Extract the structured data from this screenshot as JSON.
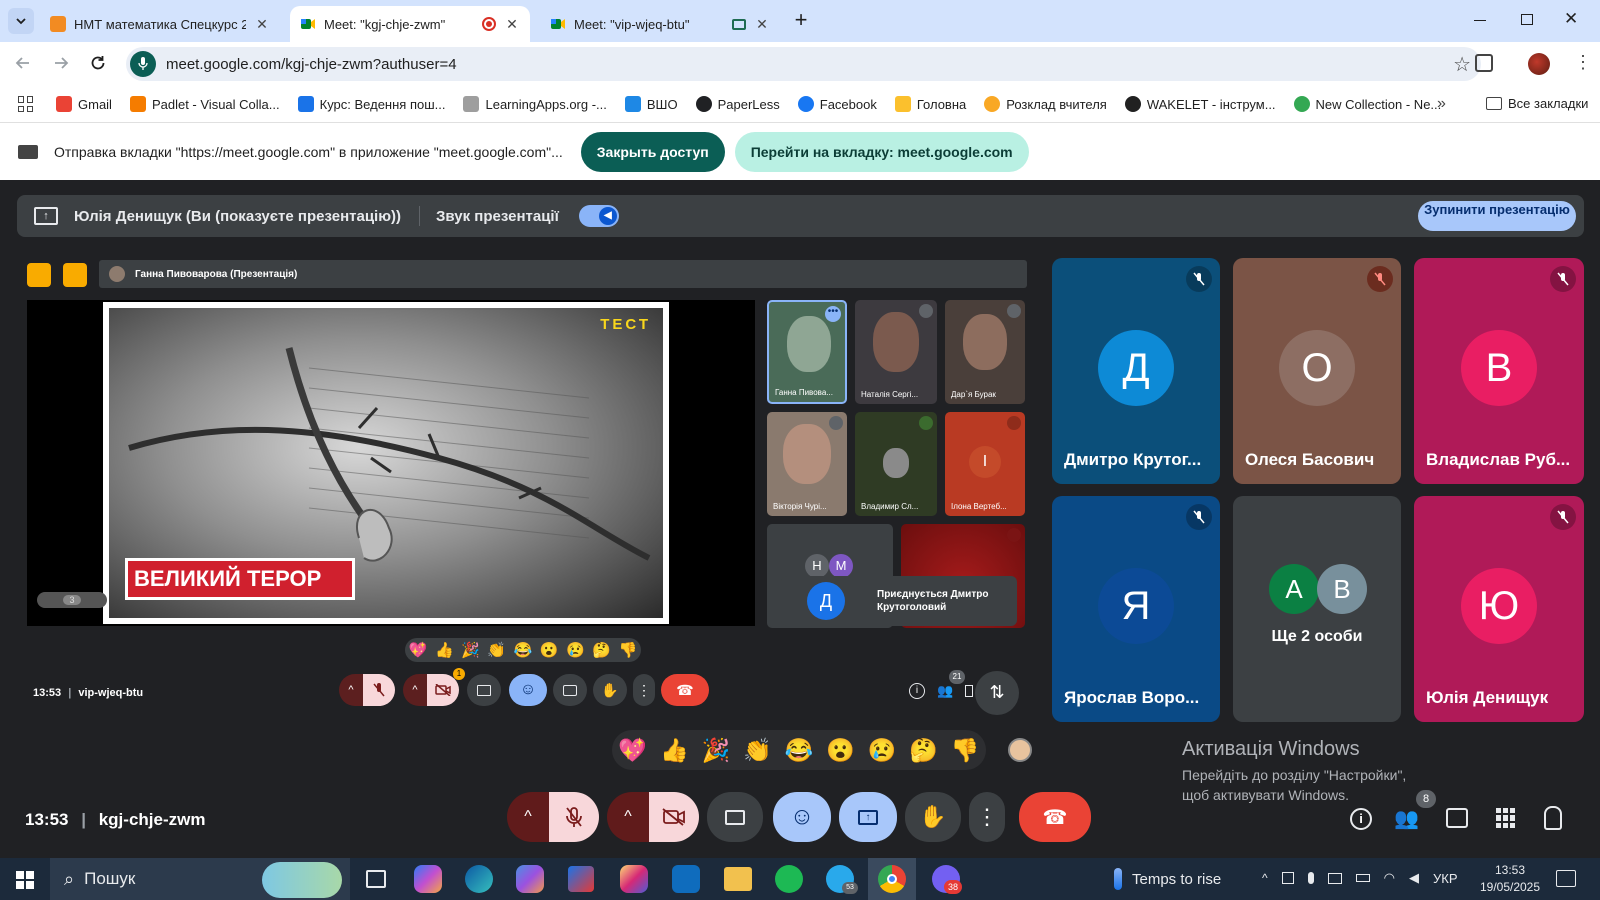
{
  "browser": {
    "tabs": [
      {
        "title": "НМТ математика Спецкурс 20",
        "icon": "orange-square-icon",
        "active": false
      },
      {
        "title": "Meet: \"kgj-chje-zwm\"",
        "icon": "google-meet-icon",
        "active": true,
        "recording": true
      },
      {
        "title": "Meet: \"vip-wjeq-btu\"",
        "icon": "google-meet-icon",
        "active": false
      }
    ],
    "url": "meet.google.com/kgj-chje-zwm?authuser=4",
    "bookmarks": [
      {
        "label": "Gmail",
        "color": "#ea4335"
      },
      {
        "label": "Padlet - Visual Colla...",
        "color": "#f57c00"
      },
      {
        "label": "Курс: Ведення пош...",
        "color": "#1a73e8"
      },
      {
        "label": "LearningApps.org -...",
        "color": "#9e9e9e"
      },
      {
        "label": "ВШО",
        "color": "#1e88e5"
      },
      {
        "label": "PaperLess",
        "color": "#202124"
      },
      {
        "label": "Facebook",
        "color": "#1877f2"
      },
      {
        "label": "Головна",
        "color": "#fbc02d"
      },
      {
        "label": "Розклад вчителя",
        "color": "#f9a825"
      },
      {
        "label": "WAKELET - інструм...",
        "color": "#212121"
      },
      {
        "label": "New Collection - Ne...",
        "color": "#34a853"
      }
    ],
    "all_bookmarks": "Все закладки"
  },
  "infobar": {
    "message": "Отправка вкладки \"https://meet.google.com\" в приложение \"meet.google.com\"...",
    "stop_label": "Закрыть доступ",
    "goto_label": "Перейти на вкладку: meet.google.com"
  },
  "presenting": {
    "text": "Юлія Денищук (Ви (показуєте презентацію))",
    "audio_label": "Звук презентації",
    "stop_label": "Зупинити презентацію"
  },
  "shared": {
    "presenter_label": "Ганна Пивоварова (Презентація)",
    "slide_title": "ВЕЛИКИЙ ТЕРОР",
    "slide_logo": "ТЕСТ",
    "slide_page": "3",
    "thumbs": [
      {
        "name": "Ганна Пивова...",
        "bg": "#4a6b58"
      },
      {
        "name": "Наталія Сергі...",
        "bg": "#3d3a3f"
      },
      {
        "name": "Дар`я Бурак",
        "bg": "#4a3f3a"
      },
      {
        "name": "Вікторія Чурі...",
        "bg": "#8a7a6e"
      },
      {
        "name": "Владимир Сл...",
        "bg": "#2f3b24"
      },
      {
        "name": "Ілона Вертеб...",
        "initial": "І",
        "bg": "#b93a23"
      }
    ],
    "mini_initials": [
      "Н",
      "М"
    ],
    "join_initial": "Д",
    "join_text": "Приєднується Дмитро Крутоголовий",
    "emojis": [
      "💖",
      "👍",
      "🎉",
      "👏",
      "😂",
      "😮",
      "😢",
      "🤔",
      "👎"
    ],
    "time": "13:53",
    "code": "vip-wjeq-btu",
    "participants_badge": "21"
  },
  "tiles": [
    {
      "name": "Дмитро Крутог...",
      "initial": "Д",
      "bg": "#0b4f7a",
      "avatar": "#0d8ad6"
    },
    {
      "name": "Олеся Басович",
      "initial": "О",
      "bg": "#7b5446",
      "avatar": "#8d6e63"
    },
    {
      "name": "Владислав Руб...",
      "initial": "В",
      "bg": "#b01a58",
      "avatar": "#e91e63"
    },
    {
      "name": "Ярослав Воро...",
      "initial": "Я",
      "bg": "#0a4a86",
      "avatar": "#0c4a96"
    },
    {
      "name": "Ще 2 особи",
      "initials": [
        "А",
        "В"
      ],
      "bg": "#3c4043"
    },
    {
      "name": "Юлія Денищук",
      "initial": "Ю",
      "bg": "#b01a58",
      "avatar": "#e91e63"
    }
  ],
  "reactions": [
    "💖",
    "👍",
    "🎉",
    "👏",
    "😂",
    "😮",
    "😢",
    "🤔",
    "👎"
  ],
  "bottom": {
    "time": "13:53",
    "code": "kgj-chje-zwm",
    "people_badge": "8"
  },
  "watermark": {
    "title": "Активація Windows",
    "line": "Перейдіть до розділу \"Настройки\", щоб активувати Windows."
  },
  "taskbar": {
    "search": "Пошук",
    "weather": "Temps to rise",
    "lang": "УКР",
    "time": "13:53",
    "date": "19/05/2025",
    "viber_badge": "38",
    "telegram_badge": "53"
  },
  "colors": {
    "meet_bg": "#202124",
    "danger": "#ea4335",
    "accent": "#a8c7fa",
    "teal": "#0b5e55"
  }
}
